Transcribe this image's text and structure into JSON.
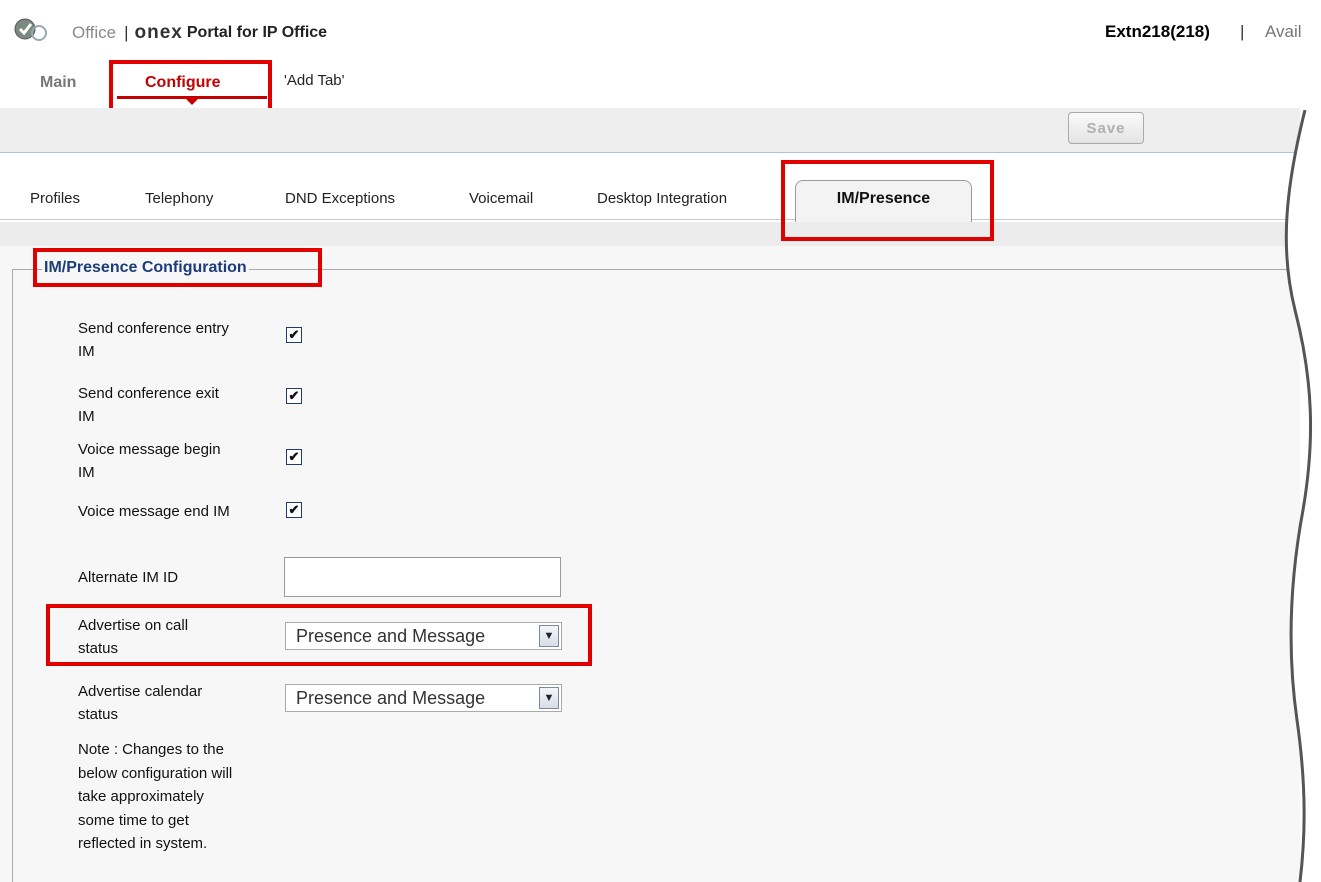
{
  "header": {
    "office": "Office",
    "separator": "|",
    "brand": "onex",
    "portal": "Portal for IP Office",
    "user": "Extn218(218)",
    "user_separator": "|",
    "status": "Avail"
  },
  "main_nav": {
    "items": [
      {
        "label": "Main"
      },
      {
        "label": "Configure"
      },
      {
        "label": "'Add Tab'"
      }
    ]
  },
  "toolbar": {
    "save_label": "Save"
  },
  "sub_tabs": {
    "items": [
      {
        "label": "Profiles"
      },
      {
        "label": "Telephony"
      },
      {
        "label": "DND Exceptions"
      },
      {
        "label": "Voicemail"
      },
      {
        "label": "Desktop Integration"
      },
      {
        "label": "IM/Presence"
      }
    ],
    "active": "IM/Presence"
  },
  "section": {
    "title": "IM/Presence Configuration",
    "checkboxes": [
      {
        "label_line1": "Send conference entry",
        "label_line2": "IM",
        "checked": true
      },
      {
        "label_line1": "Send conference exit",
        "label_line2": "IM",
        "checked": true
      },
      {
        "label_line1": "Voice message begin",
        "label_line2": "IM",
        "checked": true
      },
      {
        "label_line1": "Voice message end IM",
        "label_line2": "",
        "checked": true
      }
    ],
    "alternate_im": {
      "label": "Alternate IM ID",
      "value": ""
    },
    "advertise_call": {
      "label_line1": "Advertise on call",
      "label_line2": "status",
      "value": "Presence and Message"
    },
    "advertise_calendar": {
      "label_line1": "Advertise calendar",
      "label_line2": "status",
      "value": "Presence and Message"
    },
    "note_lines": [
      "Note : Changes to the",
      "below configuration will",
      "take approximately",
      "some time to get",
      "reflected in system."
    ]
  },
  "colors": {
    "accent_red": "#c40000",
    "highlight_red": "#e00000",
    "section_title_blue": "#1c3d7a"
  }
}
